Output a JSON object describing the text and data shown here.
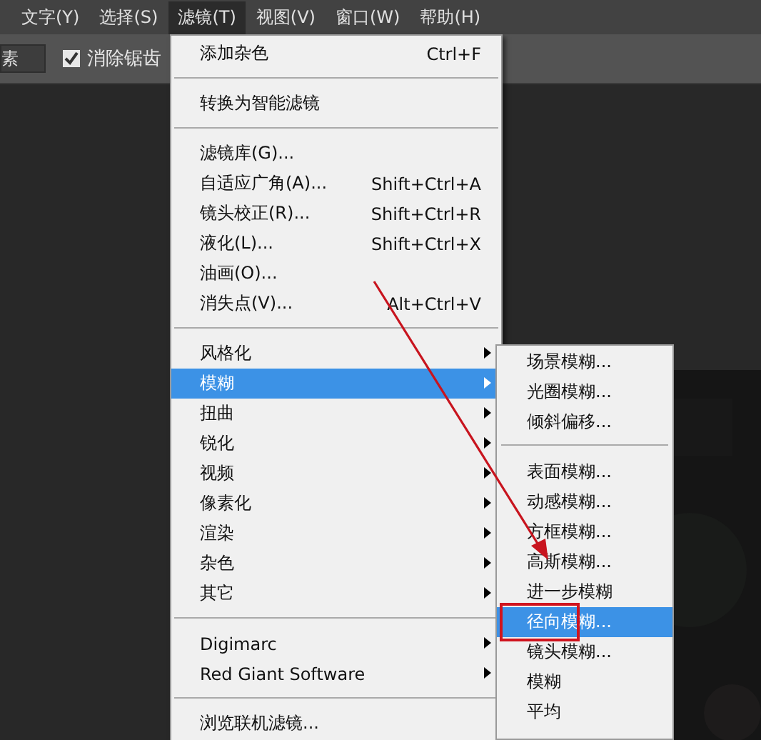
{
  "menubar": [
    {
      "label": "文字(Y)",
      "selected": false
    },
    {
      "label": "选择(S)",
      "selected": false
    },
    {
      "label": "滤镜(T)",
      "selected": true
    },
    {
      "label": "视图(V)",
      "selected": false
    },
    {
      "label": "窗口(W)",
      "selected": false
    },
    {
      "label": "帮助(H)",
      "selected": false
    }
  ],
  "options_bar": {
    "field_value": "素",
    "checkbox": {
      "label": "消除锯齿",
      "checked": true
    }
  },
  "menu": {
    "groups": [
      [
        {
          "label": "添加杂色",
          "shortcut": "Ctrl+F",
          "has_submenu": false,
          "selected": false
        }
      ],
      [
        {
          "label": "转换为智能滤镜",
          "has_submenu": false,
          "selected": false
        }
      ],
      [
        {
          "label": "滤镜库(G)...",
          "has_submenu": false,
          "selected": false
        },
        {
          "label": "自适应广角(A)...",
          "shortcut": "Shift+Ctrl+A",
          "has_submenu": false,
          "selected": false
        },
        {
          "label": "镜头校正(R)...",
          "shortcut": "Shift+Ctrl+R",
          "has_submenu": false,
          "selected": false
        },
        {
          "label": "液化(L)...",
          "shortcut": "Shift+Ctrl+X",
          "has_submenu": false,
          "selected": false
        },
        {
          "label": "油画(O)...",
          "has_submenu": false,
          "selected": false
        },
        {
          "label": "消失点(V)...",
          "shortcut": "Alt+Ctrl+V",
          "has_submenu": false,
          "selected": false
        }
      ],
      [
        {
          "label": "风格化",
          "has_submenu": true,
          "selected": false
        },
        {
          "label": "模糊",
          "has_submenu": true,
          "selected": true
        },
        {
          "label": "扭曲",
          "has_submenu": true,
          "selected": false
        },
        {
          "label": "锐化",
          "has_submenu": true,
          "selected": false
        },
        {
          "label": "视频",
          "has_submenu": true,
          "selected": false
        },
        {
          "label": "像素化",
          "has_submenu": true,
          "selected": false
        },
        {
          "label": "渲染",
          "has_submenu": true,
          "selected": false
        },
        {
          "label": "杂色",
          "has_submenu": true,
          "selected": false
        },
        {
          "label": "其它",
          "has_submenu": true,
          "selected": false
        }
      ],
      [
        {
          "label": "Digimarc",
          "has_submenu": true,
          "selected": false
        },
        {
          "label": "Red Giant Software",
          "has_submenu": true,
          "selected": false
        }
      ],
      [
        {
          "label": "浏览联机滤镜...",
          "has_submenu": false,
          "selected": false
        }
      ]
    ]
  },
  "submenu": {
    "groups": [
      [
        {
          "label": "场景模糊...",
          "selected": false
        },
        {
          "label": "光圈模糊...",
          "selected": false
        },
        {
          "label": "倾斜偏移...",
          "selected": false
        }
      ],
      [
        {
          "label": "表面模糊...",
          "selected": false
        },
        {
          "label": "动感模糊...",
          "selected": false
        },
        {
          "label": "方框模糊...",
          "selected": false
        },
        {
          "label": "高斯模糊...",
          "selected": false
        },
        {
          "label": "进一步模糊",
          "selected": false
        },
        {
          "label": "径向模糊...",
          "selected": true
        },
        {
          "label": "镜头模糊...",
          "selected": false
        },
        {
          "label": "模糊",
          "selected": false
        },
        {
          "label": "平均",
          "selected": false
        }
      ]
    ]
  }
}
